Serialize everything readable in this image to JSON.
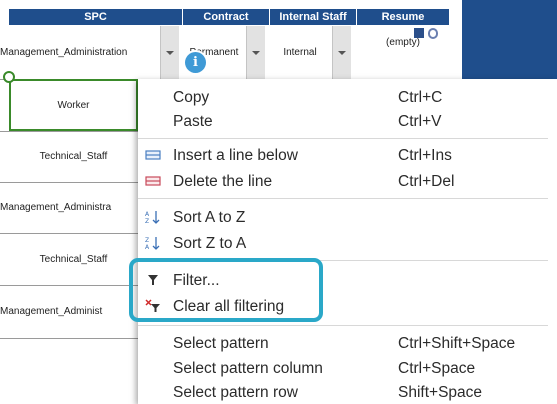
{
  "colors": {
    "header_bg": "#1f4e8c",
    "highlight": "#2aa8c8",
    "selection": "#3a8a2a",
    "info_badge": "#3f9ad6"
  },
  "table": {
    "headers": [
      "SPC",
      "Contract",
      "Internal Staff",
      "Resume"
    ],
    "first_row": {
      "spc": "Management_Administration",
      "contract": "Permanent",
      "internal": "Internal",
      "resume": "(empty)"
    },
    "spc_rows": [
      "Worker",
      "Technical_Staff",
      "Management_Administra",
      "Technical_Staff",
      "Management_Administ"
    ]
  },
  "info_badge_label": "i",
  "context_menu": {
    "copy": {
      "label": "Copy",
      "shortcut": "Ctrl+C"
    },
    "paste": {
      "label": "Paste",
      "shortcut": "Ctrl+V"
    },
    "insert": {
      "label": "Insert a line below",
      "shortcut": "Ctrl+Ins",
      "icon": "insert-row-icon"
    },
    "delete": {
      "label": "Delete the line",
      "shortcut": "Ctrl+Del",
      "icon": "delete-row-icon"
    },
    "sort_az": {
      "label": "Sort A to Z",
      "icon": "sort-az-icon"
    },
    "sort_za": {
      "label": "Sort Z to A",
      "icon": "sort-za-icon"
    },
    "filter": {
      "label": "Filter...",
      "icon": "filter-icon"
    },
    "clear_filter": {
      "label": "Clear all filtering",
      "icon": "clear-filter-icon"
    },
    "select_pattern": {
      "label": "Select pattern",
      "shortcut": "Ctrl+Shift+Space"
    },
    "select_pattern_column": {
      "label": "Select pattern column",
      "shortcut": "Ctrl+Space"
    },
    "select_pattern_row": {
      "label": "Select pattern row",
      "shortcut": "Shift+Space"
    }
  }
}
